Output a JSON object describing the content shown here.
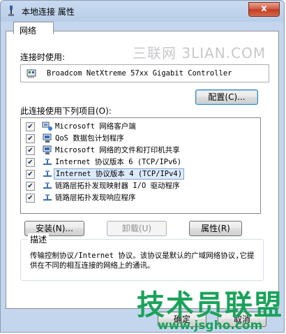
{
  "window": {
    "title": "本地连接 属性",
    "close_glyph": "x"
  },
  "tab": {
    "label": "网络"
  },
  "connect_using": {
    "label": "连接时使用:",
    "adapter_name": "Broadcom NetXtreme 57xx Gigabit Controller",
    "adapter_icon": "network-adapter-icon"
  },
  "configure_button": {
    "label": "配置(C)..."
  },
  "items_label": "此连接使用下列项目(O):",
  "items": [
    {
      "label": "Microsoft 网络客户端",
      "checked": true,
      "check_glyph": "✔",
      "icon": "network-client-icon",
      "selected": false
    },
    {
      "label": "QoS 数据包计划程序",
      "checked": true,
      "check_glyph": "✔",
      "icon": "computer-network-icon",
      "selected": false
    },
    {
      "label": "Microsoft 网络的文件和打印机共享",
      "checked": true,
      "check_glyph": "✔",
      "icon": "computer-network-icon",
      "selected": false
    },
    {
      "label": "Internet 协议版本 6 (TCP/IPv6)",
      "checked": true,
      "check_glyph": "✔",
      "icon": "protocol-icon",
      "selected": false
    },
    {
      "label": "Internet 协议版本 4 (TCP/IPv4)",
      "checked": true,
      "check_glyph": "✔",
      "icon": "protocol-icon",
      "selected": true
    },
    {
      "label": "链路层拓扑发现映射器 I/O 驱动程序",
      "checked": true,
      "check_glyph": "✔",
      "icon": "protocol-icon",
      "selected": false
    },
    {
      "label": "链路层拓扑发现响应程序",
      "checked": true,
      "check_glyph": "✔",
      "icon": "protocol-icon",
      "selected": false
    }
  ],
  "buttons": {
    "install": "安装(N)...",
    "uninstall": "卸载(U)",
    "properties": "属性(R)",
    "ok": "确定",
    "cancel": "取消"
  },
  "description": {
    "title": "描述",
    "text": "传输控制协议/Internet 协议。该协议是默认的广域网络协议,它提供在不同的相互连接的网络上的通讯。"
  },
  "watermarks": {
    "top": "三联网 3LIAN.COM",
    "bottom_big": "技术员联盟",
    "bottom_url": "www.jsgho.com"
  },
  "colors": {
    "selection_bg": "#dcebfc",
    "selection_border": "#7da2ce",
    "watermark_green": "#19a35a"
  }
}
